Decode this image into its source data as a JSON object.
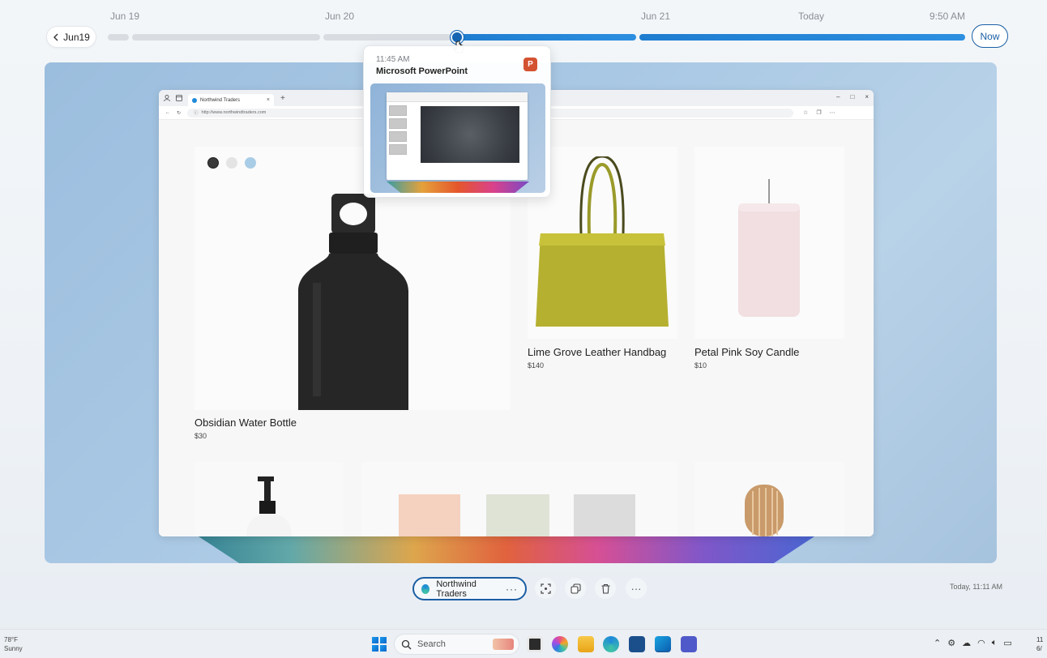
{
  "timeline": {
    "back_label": "Jun19",
    "labels": [
      "Jun 19",
      "Jun 20",
      "Jun 21",
      "Today",
      "9:50 AM"
    ],
    "now_label": "Now"
  },
  "popup": {
    "time": "11:45 AM",
    "app": "Microsoft PowerPoint",
    "app_icon": "powerpoint-icon"
  },
  "browser": {
    "tab_title": "Northwind Traders",
    "url": "http://www.northwindtraders.com"
  },
  "products": [
    {
      "name": "Obsidian  Water Bottle",
      "price": "$30"
    },
    {
      "name": "Lime Grove Leather Handbag",
      "price": "$140"
    },
    {
      "name": "Petal Pink Soy Candle",
      "price": "$10"
    }
  ],
  "swatches": [
    "#3a3a3a",
    "#e4e4e4",
    "#a9cde6"
  ],
  "action_bar": {
    "app_label": "Northwind Traders",
    "more": "···",
    "timestamp": "Today, 11:11 AM"
  },
  "taskbar": {
    "weather_temp": "78°F",
    "weather_cond": "Sunny",
    "search_placeholder": "Search",
    "clock_time": "11",
    "clock_date": "6/"
  },
  "colors": {
    "accent": "#1a5fa5",
    "timeline_blue": "#2c8fe0",
    "powerpoint": "#d35230"
  }
}
